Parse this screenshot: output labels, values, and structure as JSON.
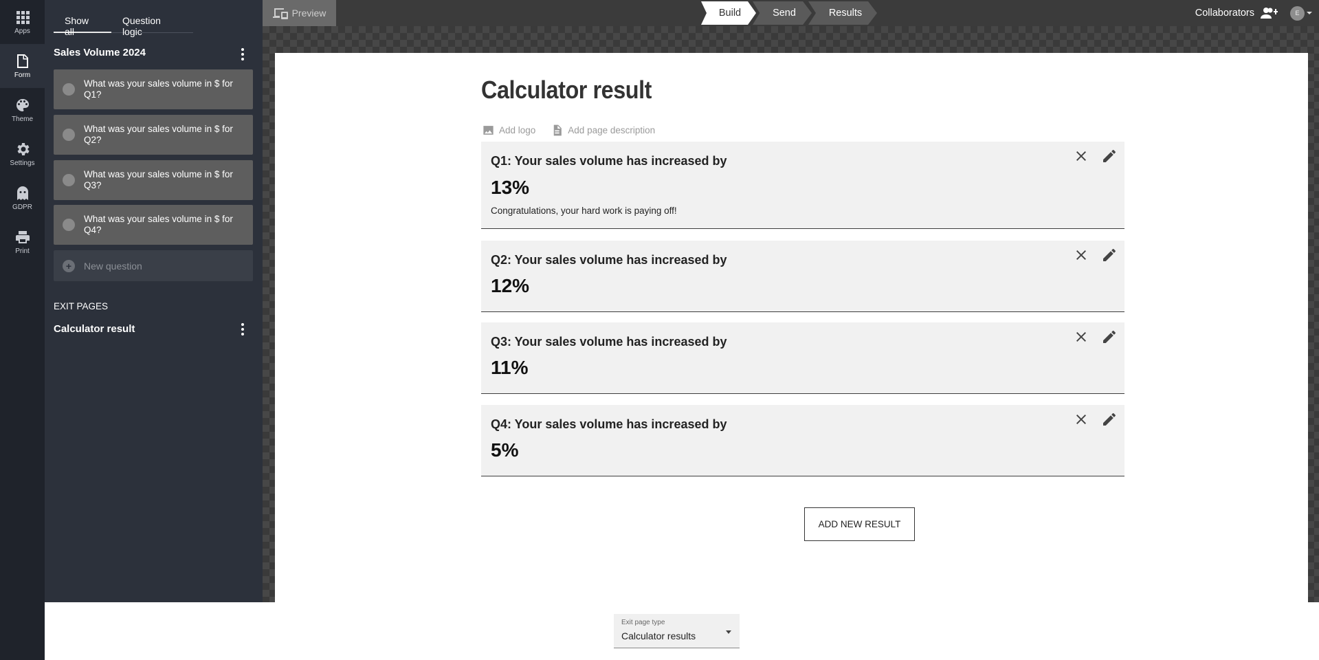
{
  "rail": [
    {
      "label": "Apps",
      "icon": "apps-icon"
    },
    {
      "label": "Form",
      "icon": "form-icon"
    },
    {
      "label": "Theme",
      "icon": "palette-icon"
    },
    {
      "label": "Settings",
      "icon": "gear-icon"
    },
    {
      "label": "GDPR",
      "icon": "ghost-icon"
    },
    {
      "label": "Print",
      "icon": "printer-icon"
    }
  ],
  "panel": {
    "tabs": [
      "Show all",
      "Question logic"
    ],
    "form_title": "Sales Volume 2024",
    "questions": [
      "What was your sales volume in $ for Q1?",
      "What was your sales volume in $ for Q2?",
      "What was your sales volume in $ for Q3?",
      "What was your sales volume in $ for Q4?"
    ],
    "new_question": "New question",
    "exit_heading": "EXIT PAGES",
    "exit_page": "Calculator result"
  },
  "topbar": {
    "preview": "Preview",
    "steps": [
      "Build",
      "Send",
      "Results"
    ],
    "collaborators": "Collaborators",
    "avatar_initial": "E"
  },
  "page": {
    "title": "Calculator result",
    "add_logo": "Add logo",
    "add_description": "Add page description",
    "results": [
      {
        "heading": "Q1: Your sales volume has increased by",
        "value": "13%",
        "description": "Congratulations, your hard work is paying off!"
      },
      {
        "heading": "Q2: Your sales volume has increased by",
        "value": "12%",
        "description": ""
      },
      {
        "heading": "Q3: Your sales volume has increased by",
        "value": "11%",
        "description": ""
      },
      {
        "heading": "Q4: Your sales volume has increased by",
        "value": "5%",
        "description": ""
      }
    ],
    "add_result": "ADD NEW RESULT"
  },
  "bottom": {
    "exit_type_label": "Exit page type",
    "exit_type_value": "Calculator results"
  }
}
